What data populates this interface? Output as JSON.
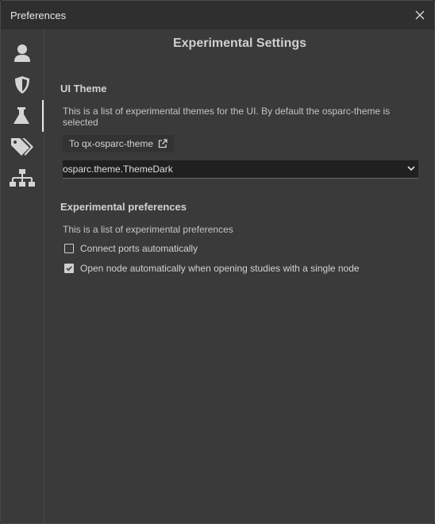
{
  "window": {
    "title": "Preferences"
  },
  "sidebar": {
    "items": [
      {
        "name": "profile",
        "icon": "user-icon"
      },
      {
        "name": "security",
        "icon": "shield-icon"
      },
      {
        "name": "experimental",
        "icon": "flask-icon",
        "active": true
      },
      {
        "name": "tags",
        "icon": "tags-icon"
      },
      {
        "name": "clusters",
        "icon": "sitemap-icon"
      }
    ]
  },
  "main": {
    "title": "Experimental Settings",
    "ui_theme": {
      "heading": "UI Theme",
      "description": "This is a list of experimental themes for the UI. By default the osparc-theme is selected",
      "link_label": "To qx-osparc-theme",
      "selected_theme": "osparc.theme.ThemeDark"
    },
    "experimental_prefs": {
      "heading": "Experimental preferences",
      "description": "This is a list of experimental preferences",
      "options": [
        {
          "label": "Connect ports automatically",
          "checked": false
        },
        {
          "label": "Open node automatically when opening studies with a single node",
          "checked": true
        }
      ]
    }
  }
}
